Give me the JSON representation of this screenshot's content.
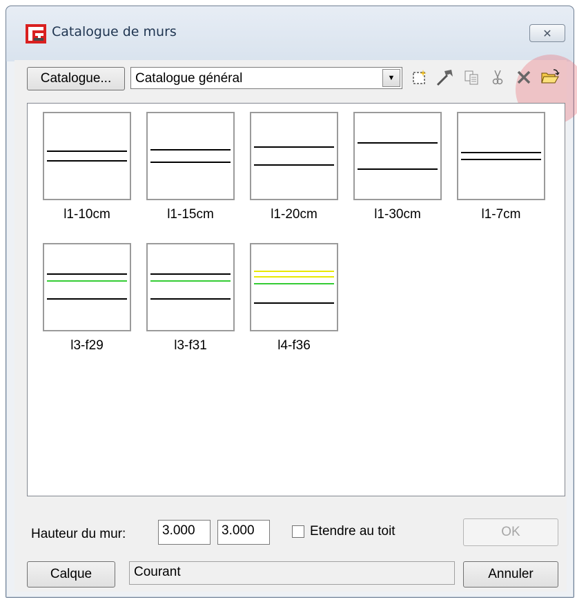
{
  "window": {
    "title": "Catalogue de murs",
    "close_glyph": "✕"
  },
  "toolbar": {
    "catalogue_button": "Catalogue...",
    "catalogue_select": "Catalogue général",
    "tools": [
      {
        "name": "new-icon"
      },
      {
        "name": "edit-icon"
      },
      {
        "name": "copy-icon"
      },
      {
        "name": "cut-icon"
      },
      {
        "name": "delete-icon"
      },
      {
        "name": "open-folder-icon"
      }
    ]
  },
  "walls": [
    {
      "label": "l1-10cm",
      "lines": [
        {
          "color": "#000000"
        },
        {
          "color": "#000000"
        }
      ]
    },
    {
      "label": "l1-15cm",
      "lines": [
        {
          "color": "#000000"
        },
        {
          "color": "#000000"
        }
      ]
    },
    {
      "label": "l1-20cm",
      "lines": [
        {
          "color": "#000000"
        },
        {
          "color": "#000000"
        }
      ]
    },
    {
      "label": "l1-30cm",
      "lines": [
        {
          "color": "#000000"
        },
        {
          "color": "#000000"
        }
      ]
    },
    {
      "label": "l1-7cm",
      "lines": [
        {
          "color": "#000000"
        },
        {
          "color": "#000000"
        }
      ]
    },
    {
      "label": "l3-f29",
      "lines": [
        {
          "color": "#000000"
        },
        {
          "color": "#33cc33"
        },
        {
          "color": "#000000"
        }
      ]
    },
    {
      "label": "l3-f31",
      "lines": [
        {
          "color": "#000000"
        },
        {
          "color": "#33cc33"
        },
        {
          "color": "#000000"
        }
      ]
    },
    {
      "label": "l4-f36",
      "lines": [
        {
          "color": "#e8e800"
        },
        {
          "color": "#e8e800"
        },
        {
          "color": "#33cc33"
        },
        {
          "color": "#000000"
        }
      ]
    }
  ],
  "form": {
    "height_label": "Hauteur du mur:",
    "height_value_1": "3.000",
    "height_value_2": "3.000",
    "extend_roof_label": "Etendre au toit",
    "extend_roof_checked": false,
    "layer_button": "Calque",
    "layer_value": "Courant",
    "ok_button": "OK",
    "cancel_button": "Annuler"
  },
  "colors": {
    "highlight": "#eb7882"
  }
}
